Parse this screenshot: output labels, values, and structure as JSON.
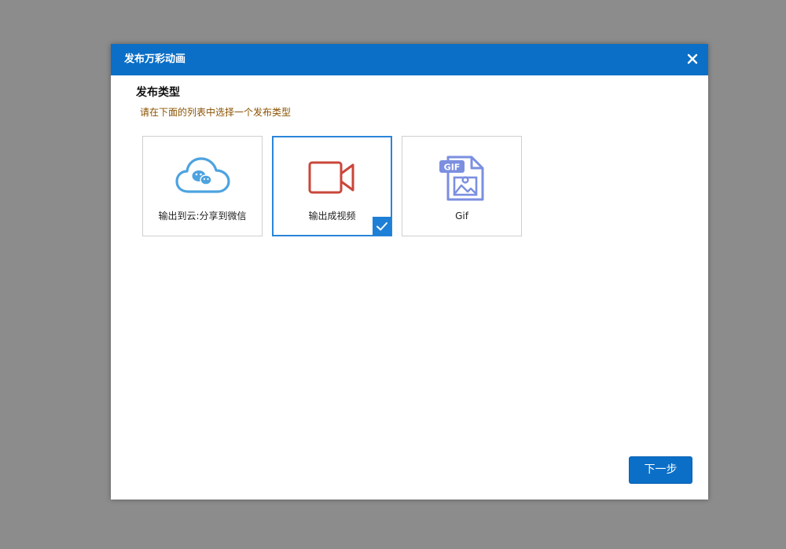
{
  "dialog": {
    "title": "发布万彩动画",
    "close_icon": "close-icon"
  },
  "section": {
    "title": "发布类型",
    "hint": "请在下面的列表中选择一个发布类型"
  },
  "options": [
    {
      "label": "输出到云:分享到微信",
      "icon": "cloud-wechat-icon",
      "selected": false
    },
    {
      "label": "输出成视频",
      "icon": "video-camera-icon",
      "selected": true
    },
    {
      "label": "Gif",
      "icon": "gif-file-icon",
      "selected": false,
      "icon_text": "GIF"
    }
  ],
  "footer": {
    "next_label": "下一步"
  },
  "colors": {
    "titlebar": "#0b6fc7",
    "accent": "#1e7fd6",
    "cloud": "#4da3e0",
    "video": "#c9473a",
    "gif": "#7b8fe0",
    "hint": "#8a5200"
  }
}
